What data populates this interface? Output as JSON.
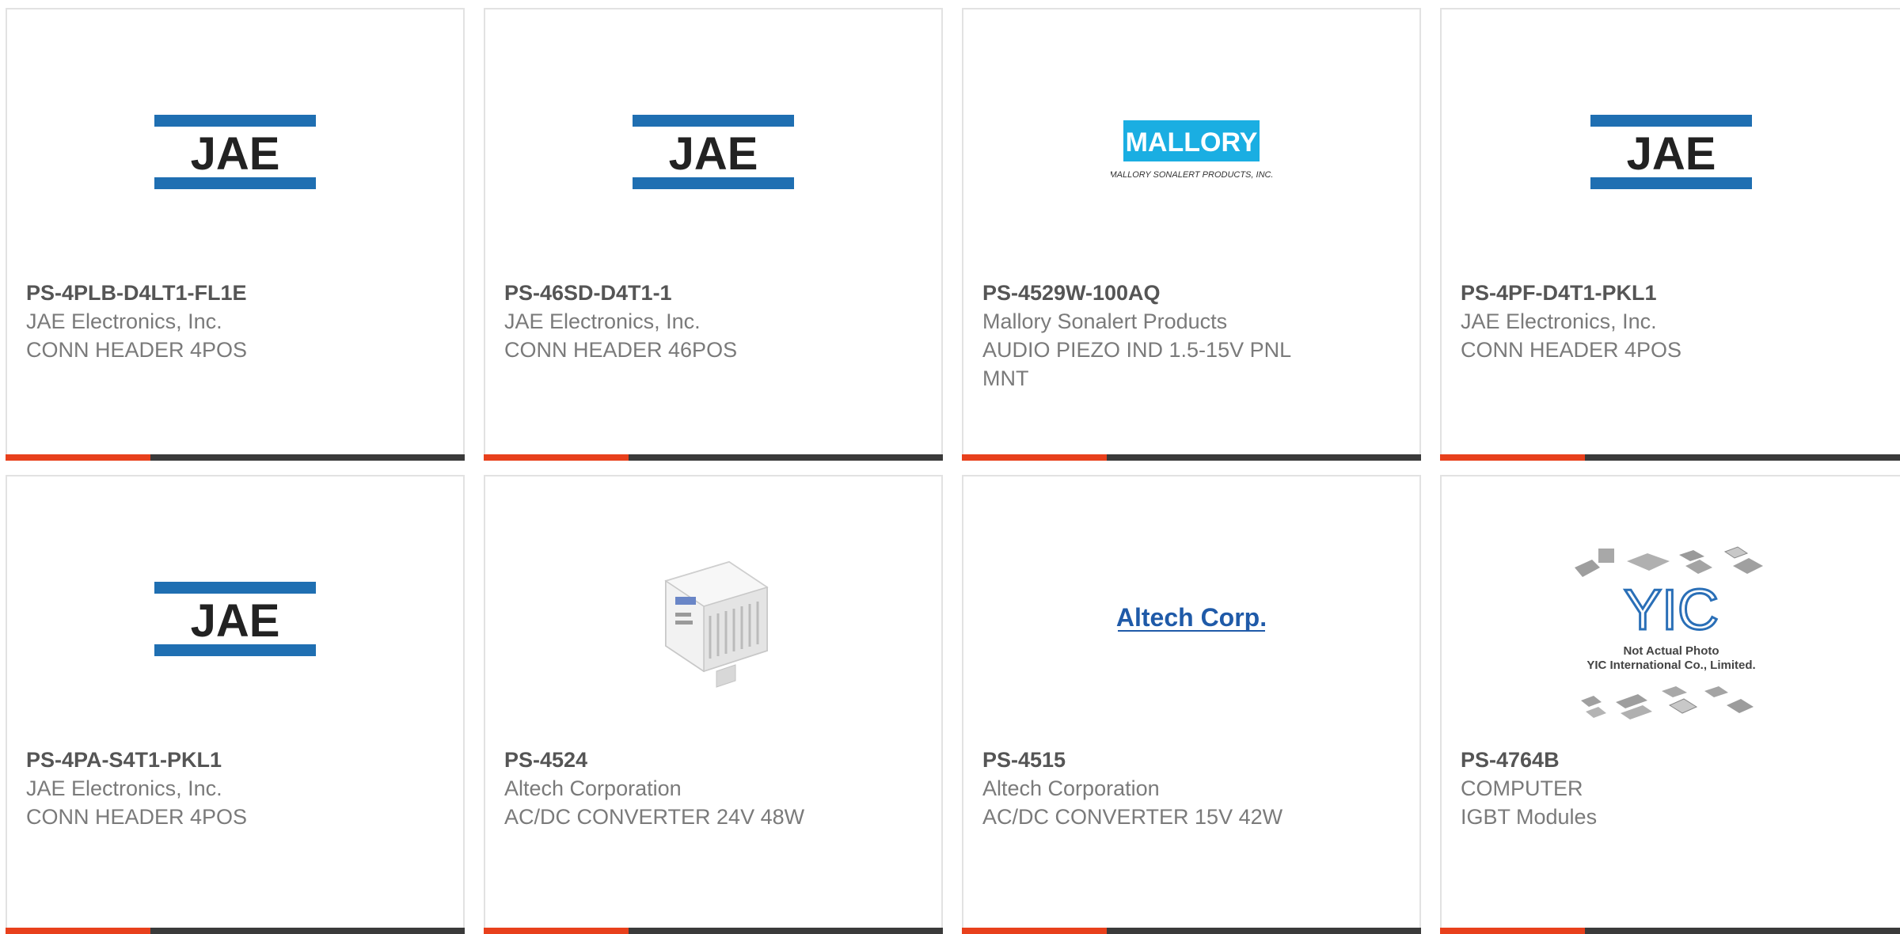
{
  "colors": {
    "accent": "#e8401c",
    "bar": "#3a3a3a",
    "jae_blue": "#1f6fb2",
    "mallory_blue": "#1aaee2",
    "altech_blue": "#1f5aa8",
    "yic_blue": "#2a6fb7"
  },
  "brands": {
    "jae": "JAE",
    "mallory": "MALLORY",
    "mallory_sub": "MALLORY SONALERT PRODUCTS, INC.",
    "altech": "Altech Corp.",
    "yic_note": "Not Actual Photo",
    "yic_company": "YIC International Co., Limited."
  },
  "products": [
    {
      "part_number": "PS-4PLB-D4LT1-FL1E",
      "manufacturer": "JAE Electronics, Inc.",
      "description": "CONN HEADER 4POS",
      "image": "jae-logo"
    },
    {
      "part_number": "PS-46SD-D4T1-1",
      "manufacturer": "JAE Electronics, Inc.",
      "description": "CONN HEADER 46POS",
      "image": "jae-logo"
    },
    {
      "part_number": "PS-4529W-100AQ",
      "manufacturer": "Mallory Sonalert Products",
      "description": "AUDIO PIEZO IND 1.5-15V PNL MNT",
      "image": "mallory-logo"
    },
    {
      "part_number": "PS-4PF-D4T1-PKL1",
      "manufacturer": "JAE Electronics, Inc.",
      "description": "CONN HEADER 4POS",
      "image": "jae-logo"
    },
    {
      "part_number": "PS-4PA-S4T1-PKL1",
      "manufacturer": "JAE Electronics, Inc.",
      "description": "CONN HEADER 4POS",
      "image": "jae-logo"
    },
    {
      "part_number": "PS-4524",
      "manufacturer": "Altech Corporation",
      "description": "AC/DC CONVERTER 24V 48W",
      "image": "power-supply-photo"
    },
    {
      "part_number": "PS-4515",
      "manufacturer": "Altech Corporation",
      "description": "AC/DC CONVERTER 15V 42W",
      "image": "altech-logo"
    },
    {
      "part_number": "PS-4764B",
      "manufacturer": "COMPUTER",
      "description": "IGBT Modules",
      "image": "yic-placeholder"
    }
  ]
}
